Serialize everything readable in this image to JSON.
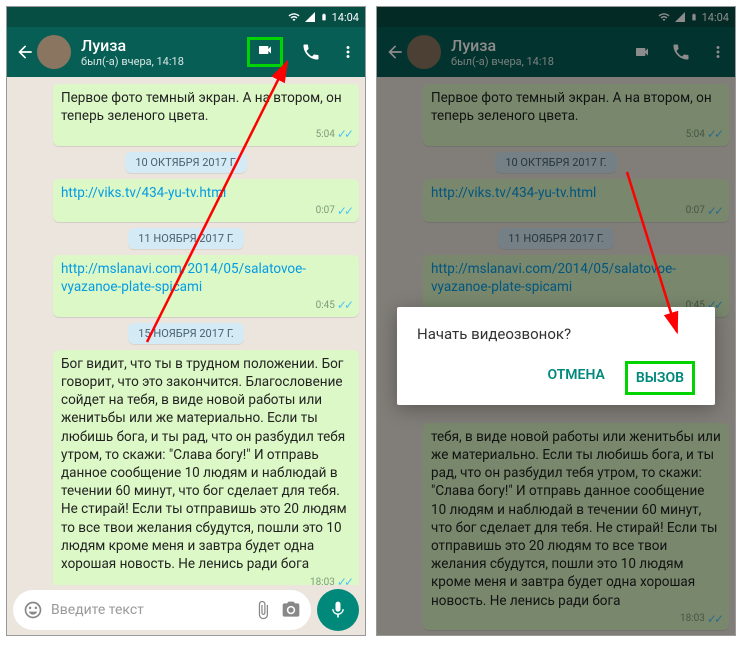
{
  "statusbar": {
    "time": "14:04"
  },
  "header": {
    "contact_name": "Луиза",
    "contact_status": "был(-а) вчера, 14:18"
  },
  "chat": {
    "msg1": {
      "text": "Первое фото темный экран. А на втором, он теперь зеленого цвета.",
      "time": "5:04"
    },
    "date1": "10 ОКТЯБРЯ 2017 Г.",
    "link1": {
      "url": "http://viks.tv/434-yu-tv.html",
      "time": "0:07"
    },
    "date2": "11 НОЯБРЯ 2017 Г.",
    "link2": {
      "url": "http://mslanavi.com/2014/05/salatovoe-vyazanoe-plate-spicami",
      "time": "0:45"
    },
    "date3": "15 НОЯБРЯ 2017 Г.",
    "msg2": {
      "text": "Бог видит, что ты в трудном положении. Бог говорит,  что это закончится. Благословение сойдет на тебя, в виде новой работы или женитьбы или же материально. Если ты любишь бога, и ты рад, что он разбудил тебя утром, то скажи: \"Слава богу!\"  И отправь данное сообщение 10 людям и наблюдай в течении 60 минут, что бог сделает для тебя. Не стирай! Если ты отправишь это 20 людям то все твои желания сбудутся, пошли это 10 людям кроме меня и завтра будет одна хорошая новость. Не ленись ради бога",
      "time": "18:03"
    },
    "msg2_partial": {
      "text": "тебя, в виде новой работы или женитьбы или же материально. Если ты любишь бога, и ты рад, что он разбудил тебя утром, то скажи: \"Слава богу!\"  И отправь данное сообщение 10 людям и наблюдай в течении 60 минут, что бог сделает для тебя. Не стирай! Если ты отправишь это 20 людям то все твои желания сбудутся, пошли это 10 людям кроме меня и завтра будет одна хорошая новость. Не ленись ради бога",
      "time": "18:03"
    }
  },
  "input": {
    "placeholder": "Введите текст"
  },
  "dialog": {
    "title": "Начать видеозвонок?",
    "cancel": "ОТМЕНА",
    "call": "ВЫЗОВ"
  }
}
